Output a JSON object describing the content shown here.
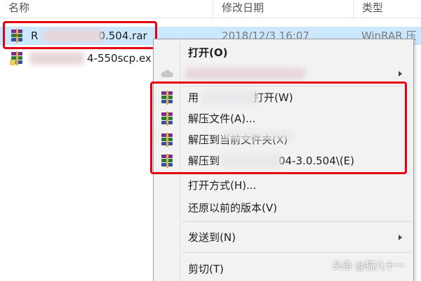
{
  "columns": {
    "name": "名称",
    "date": "修改日期",
    "type": "类型"
  },
  "files": [
    {
      "name_prefix": "R",
      "name_suffix": "0.504.rar",
      "date": "2018/12/3 16:07",
      "type": "WinRAR 压",
      "icon": "winrar-archive-icon"
    },
    {
      "name_suffix": "4-550scp.ex",
      "icon": "winrar-exe-icon"
    }
  ],
  "context_menu": {
    "items": [
      {
        "label": "打开(O)",
        "bold": true
      },
      {
        "label": "",
        "icon": "cloud-icon",
        "submenu": true
      },
      {
        "label_prefix": "用",
        "label_suffix": "打开(W)",
        "icon": "winrar-icon"
      },
      {
        "label": "解压文件(A)...",
        "icon": "winrar-icon"
      },
      {
        "label": "解压到当前文件夹(X)",
        "icon": "winrar-icon"
      },
      {
        "label_prefix": "解压到",
        "label_suffix": "04-3.0.504\\(E)",
        "icon": "winrar-icon"
      },
      {
        "label": "打开方式(H)..."
      },
      {
        "label": "还原以前的版本(V)"
      },
      {
        "label": "发送到(N)",
        "submenu": true
      },
      {
        "label": "剪切(T)"
      }
    ]
  },
  "highlight_color": "#e60012",
  "selection_color": "#cce8ff",
  "watermark": "头条 @猫儿十一"
}
